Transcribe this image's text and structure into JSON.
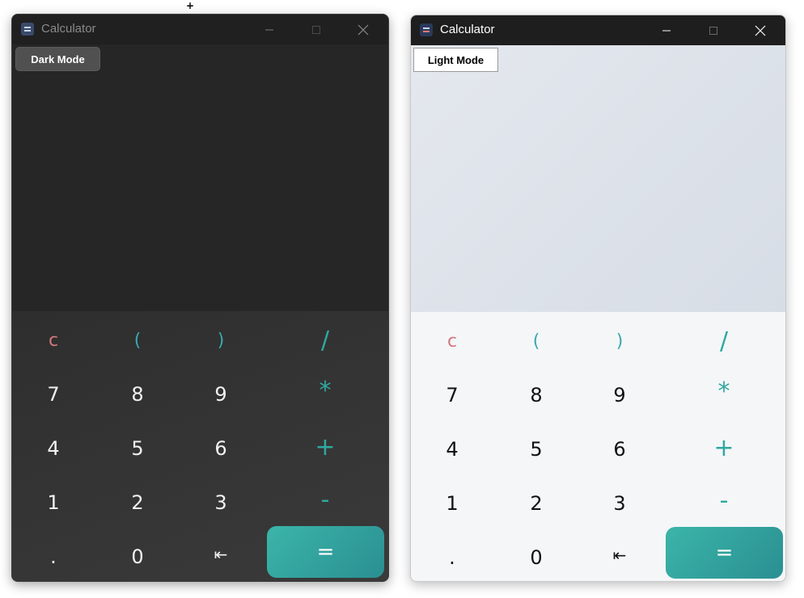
{
  "cursor": "+",
  "windows": [
    {
      "id": "dark",
      "title": "Calculator",
      "mode_button": "Dark Mode",
      "keys": {
        "clear": "c",
        "lparen": "(",
        "rparen": ")",
        "divide": "/",
        "seven": "7",
        "eight": "8",
        "nine": "9",
        "multiply": "*",
        "four": "4",
        "five": "5",
        "six": "6",
        "plus": "+",
        "one": "1",
        "two": "2",
        "three": "3",
        "minus": "-",
        "dot": ".",
        "zero": "0",
        "backspace": "⇤",
        "equals": "="
      }
    },
    {
      "id": "light",
      "title": "Calculator",
      "mode_button": "Light Mode",
      "keys": {
        "clear": "c",
        "lparen": "(",
        "rparen": ")",
        "divide": "/",
        "seven": "7",
        "eight": "8",
        "nine": "9",
        "multiply": "*",
        "four": "4",
        "five": "5",
        "six": "6",
        "plus": "+",
        "one": "1",
        "two": "2",
        "three": "3",
        "minus": "-",
        "dot": ".",
        "zero": "0",
        "backspace": "⇤",
        "equals": "="
      }
    }
  ],
  "colors": {
    "accent_teal": "#2fa99f",
    "clear_red": "#d07a7e",
    "paren_blue": "#3aa8b0"
  }
}
